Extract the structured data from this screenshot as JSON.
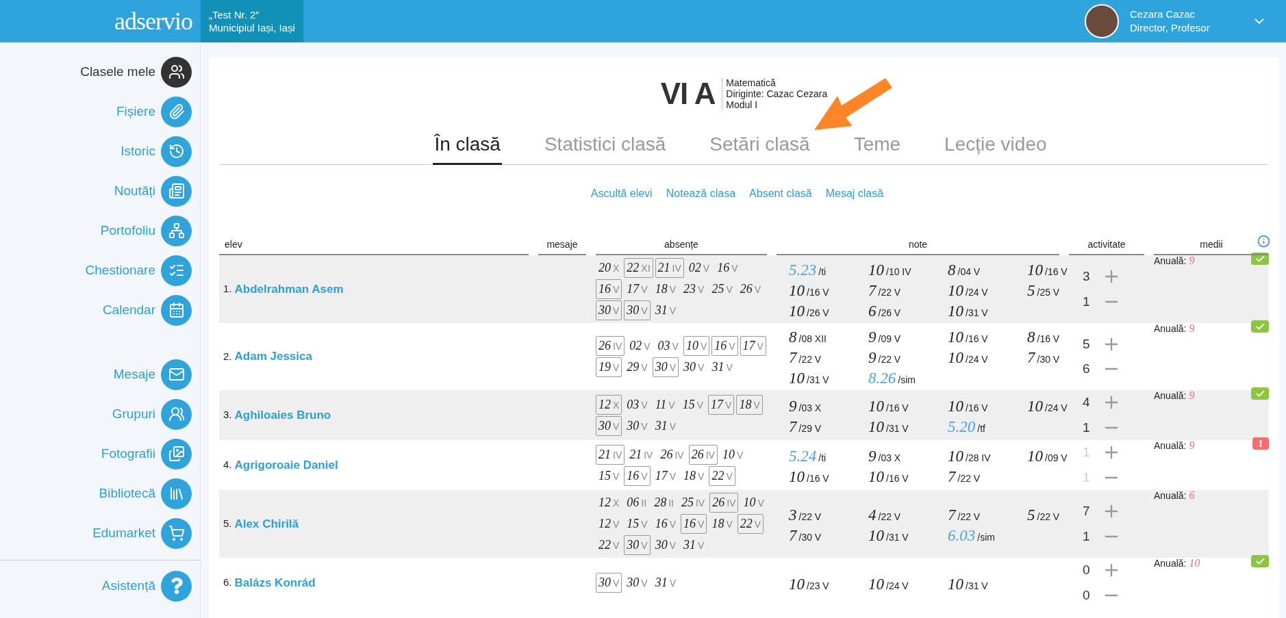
{
  "header": {
    "logo": "adservio",
    "school": {
      "name": "„Test Nr. 2”",
      "location": "Municipiul Iași, Iași"
    },
    "user": {
      "name": "Cezara Cazac",
      "role": "Director, Profesor"
    }
  },
  "sidebar": {
    "items": [
      {
        "label": "Clasele mele",
        "selected": true
      },
      {
        "label": "Fișiere",
        "selected": false
      },
      {
        "label": "Istoric",
        "selected": false
      },
      {
        "label": "Noutăți",
        "selected": false
      },
      {
        "label": "Portofoliu",
        "selected": false
      },
      {
        "label": "Chestionare",
        "selected": false
      },
      {
        "label": "Calendar",
        "selected": false
      }
    ],
    "items_2": [
      {
        "label": "Mesaje",
        "selected": false
      },
      {
        "label": "Grupuri",
        "selected": false
      },
      {
        "label": "Fotografii",
        "selected": false
      },
      {
        "label": "Bibliotecă",
        "selected": false
      },
      {
        "label": "Edumarket",
        "selected": false
      }
    ],
    "footer_item": {
      "label": "Asistență",
      "selected": false
    }
  },
  "class_info": {
    "name": "VI A",
    "subject": "Matematică",
    "head_teacher": "Diriginte: Cazac Cezara",
    "module": "Modul I"
  },
  "tabs": [
    {
      "label": "În clasă",
      "selected": true
    },
    {
      "label": "Statistici clasă",
      "selected": false
    },
    {
      "label": "Setări clasă",
      "selected": false
    },
    {
      "label": "Teme",
      "selected": false
    },
    {
      "label": "Lecție video",
      "selected": false
    }
  ],
  "actions": [
    "Ascultă elevi",
    "Notează clasa",
    "Absent clasă",
    "Mesaj clasă"
  ],
  "table": {
    "columns": [
      "elev",
      "mesaje",
      "absențe",
      "note",
      "activitate",
      "medii"
    ],
    "rows": [
      {
        "index": "1.",
        "name": "Abdelrahman Asem",
        "absences": [
          {
            "day": "20",
            "month": "X",
            "boxed": false
          },
          {
            "day": "22",
            "month": "XI",
            "boxed": true
          },
          {
            "day": "21",
            "month": "IV",
            "boxed": true
          },
          {
            "day": "02",
            "month": "V",
            "boxed": false
          },
          {
            "day": "16",
            "month": "V",
            "boxed": false
          },
          {
            "day": "16",
            "month": "V",
            "boxed": true
          },
          {
            "day": "17",
            "month": "V",
            "boxed": false
          },
          {
            "day": "18",
            "month": "V",
            "boxed": false
          },
          {
            "day": "23",
            "month": "V",
            "boxed": false
          },
          {
            "day": "25",
            "month": "V",
            "boxed": false
          },
          {
            "day": "26",
            "month": "V",
            "boxed": false
          },
          {
            "day": "30",
            "month": "V",
            "boxed": true
          },
          {
            "day": "30",
            "month": "V",
            "boxed": true
          },
          {
            "day": "31",
            "month": "V",
            "boxed": false
          }
        ],
        "grades": [
          {
            "value": "5.23",
            "date": "/ti",
            "kind": "average"
          },
          {
            "value": "10",
            "date": "/10 IV",
            "kind": "grade"
          },
          {
            "value": "8",
            "date": "/04 V",
            "kind": "grade"
          },
          {
            "value": "10",
            "date": "/16 V",
            "kind": "grade"
          },
          {
            "value": "10",
            "date": "/16 V",
            "kind": "grade"
          },
          {
            "value": "7",
            "date": "/22 V",
            "kind": "grade"
          },
          {
            "value": "10",
            "date": "/24 V",
            "kind": "grade"
          },
          {
            "value": "5",
            "date": "/25 V",
            "kind": "grade"
          },
          {
            "value": "10",
            "date": "/26 V",
            "kind": "grade"
          },
          {
            "value": "6",
            "date": "/26 V",
            "kind": "grade"
          },
          {
            "value": "10",
            "date": "/31 V",
            "kind": "grade"
          }
        ],
        "activity": {
          "plus": "3",
          "minus": "1",
          "dimmed": false
        },
        "average_label": "Anuală:",
        "average": "9",
        "badge": true,
        "warning": false
      },
      {
        "index": "2.",
        "name": "Adam Jessica",
        "absences": [
          {
            "day": "26",
            "month": "IV",
            "boxed": true
          },
          {
            "day": "02",
            "month": "V",
            "boxed": false
          },
          {
            "day": "03",
            "month": "V",
            "boxed": false
          },
          {
            "day": "10",
            "month": "V",
            "boxed": true
          },
          {
            "day": "16",
            "month": "V",
            "boxed": true
          },
          {
            "day": "17",
            "month": "V",
            "boxed": true
          },
          {
            "day": "19",
            "month": "V",
            "boxed": true
          },
          {
            "day": "29",
            "month": "V",
            "boxed": false
          },
          {
            "day": "30",
            "month": "V",
            "boxed": true
          },
          {
            "day": "30",
            "month": "V",
            "boxed": false
          },
          {
            "day": "31",
            "month": "V",
            "boxed": false
          }
        ],
        "grades": [
          {
            "value": "8",
            "date": "/08 XII",
            "kind": "grade"
          },
          {
            "value": "9",
            "date": "/09 V",
            "kind": "grade"
          },
          {
            "value": "10",
            "date": "/16 V",
            "kind": "grade"
          },
          {
            "value": "8",
            "date": "/16 V",
            "kind": "grade"
          },
          {
            "value": "7",
            "date": "/22 V",
            "kind": "grade"
          },
          {
            "value": "9",
            "date": "/22 V",
            "kind": "grade"
          },
          {
            "value": "10",
            "date": "/24 V",
            "kind": "grade"
          },
          {
            "value": "7",
            "date": "/30 V",
            "kind": "grade"
          },
          {
            "value": "10",
            "date": "/31 V",
            "kind": "grade"
          },
          {
            "value": "8.26",
            "date": "/sim",
            "kind": "average"
          }
        ],
        "activity": {
          "plus": "5",
          "minus": "6",
          "dimmed": false
        },
        "average_label": "Anuală:",
        "average": "9",
        "badge": true,
        "warning": false
      },
      {
        "index": "3.",
        "name": "Aghiloaies Bruno",
        "absences": [
          {
            "day": "12",
            "month": "X",
            "boxed": true
          },
          {
            "day": "03",
            "month": "V",
            "boxed": false
          },
          {
            "day": "11",
            "month": "V",
            "boxed": false
          },
          {
            "day": "15",
            "month": "V",
            "boxed": false
          },
          {
            "day": "17",
            "month": "V",
            "boxed": true
          },
          {
            "day": "18",
            "month": "V",
            "boxed": true
          },
          {
            "day": "30",
            "month": "V",
            "boxed": true
          },
          {
            "day": "30",
            "month": "V",
            "boxed": false
          },
          {
            "day": "31",
            "month": "V",
            "boxed": false
          }
        ],
        "grades": [
          {
            "value": "9",
            "date": "/03 X",
            "kind": "grade"
          },
          {
            "value": "10",
            "date": "/16 V",
            "kind": "grade"
          },
          {
            "value": "10",
            "date": "/16 V",
            "kind": "grade"
          },
          {
            "value": "10",
            "date": "/24 V",
            "kind": "grade"
          },
          {
            "value": "7",
            "date": "/29 V",
            "kind": "grade"
          },
          {
            "value": "10",
            "date": "/31 V",
            "kind": "grade"
          },
          {
            "value": "5.20",
            "date": "/tf",
            "kind": "average"
          }
        ],
        "activity": {
          "plus": "4",
          "minus": "1",
          "dimmed": false
        },
        "average_label": "Anuală:",
        "average": "9",
        "badge": true,
        "warning": false
      },
      {
        "index": "4.",
        "name": "Agrigoroaie Daniel",
        "absences": [
          {
            "day": "21",
            "month": "IV",
            "boxed": true
          },
          {
            "day": "21",
            "month": "IV",
            "boxed": false
          },
          {
            "day": "26",
            "month": "IV",
            "boxed": false
          },
          {
            "day": "26",
            "month": "IV",
            "boxed": true
          },
          {
            "day": "10",
            "month": "V",
            "boxed": false
          },
          {
            "day": "15",
            "month": "V",
            "boxed": false
          },
          {
            "day": "16",
            "month": "V",
            "boxed": true
          },
          {
            "day": "17",
            "month": "V",
            "boxed": false
          },
          {
            "day": "18",
            "month": "V",
            "boxed": false
          },
          {
            "day": "22",
            "month": "V",
            "boxed": true
          }
        ],
        "grades": [
          {
            "value": "5.24",
            "date": "/ti",
            "kind": "average"
          },
          {
            "value": "9",
            "date": "/03 X",
            "kind": "grade"
          },
          {
            "value": "10",
            "date": "/28 IV",
            "kind": "grade"
          },
          {
            "value": "10",
            "date": "/09 V",
            "kind": "grade"
          },
          {
            "value": "10",
            "date": "/16 V",
            "kind": "grade"
          },
          {
            "value": "10",
            "date": "/16 V",
            "kind": "grade"
          },
          {
            "value": "7",
            "date": "/22 V",
            "kind": "grade"
          }
        ],
        "activity": {
          "plus": "1",
          "minus": "1",
          "dimmed": true
        },
        "average_label": "Anuală:",
        "average": "9",
        "badge": true,
        "warning": true
      },
      {
        "index": "5.",
        "name": "Alex Chirilă",
        "absences": [
          {
            "day": "12",
            "month": "X",
            "boxed": false
          },
          {
            "day": "06",
            "month": "II",
            "boxed": false
          },
          {
            "day": "28",
            "month": "II",
            "boxed": false
          },
          {
            "day": "25",
            "month": "IV",
            "boxed": false
          },
          {
            "day": "26",
            "month": "IV",
            "boxed": true
          },
          {
            "day": "10",
            "month": "V",
            "boxed": false
          },
          {
            "day": "12",
            "month": "V",
            "boxed": false
          },
          {
            "day": "15",
            "month": "V",
            "boxed": false
          },
          {
            "day": "16",
            "month": "V",
            "boxed": false
          },
          {
            "day": "16",
            "month": "V",
            "boxed": true
          },
          {
            "day": "18",
            "month": "V",
            "boxed": false
          },
          {
            "day": "22",
            "month": "V",
            "boxed": true
          },
          {
            "day": "22",
            "month": "V",
            "boxed": false
          },
          {
            "day": "30",
            "month": "V",
            "boxed": true
          },
          {
            "day": "30",
            "month": "V",
            "boxed": false
          },
          {
            "day": "31",
            "month": "V",
            "boxed": false
          }
        ],
        "grades": [
          {
            "value": "3",
            "date": "/22 V",
            "kind": "grade"
          },
          {
            "value": "4",
            "date": "/22 V",
            "kind": "grade"
          },
          {
            "value": "7",
            "date": "/22 V",
            "kind": "grade"
          },
          {
            "value": "5",
            "date": "/22 V",
            "kind": "grade"
          },
          {
            "value": "7",
            "date": "/30 V",
            "kind": "grade"
          },
          {
            "value": "10",
            "date": "/31 V",
            "kind": "grade"
          },
          {
            "value": "6.03",
            "date": "/sim",
            "kind": "average"
          }
        ],
        "activity": {
          "plus": "7",
          "minus": "1",
          "dimmed": false
        },
        "average_label": "Anuală:",
        "average": "6",
        "badge": false
      },
      {
        "index": "6.",
        "name": "Balázs Konrád",
        "absences": [
          {
            "day": "30",
            "month": "V",
            "boxed": true
          },
          {
            "day": "30",
            "month": "V",
            "boxed": false
          },
          {
            "day": "31",
            "month": "V",
            "boxed": false
          }
        ],
        "grades": [
          {
            "value": "10",
            "date": "/23 V",
            "kind": "grade"
          },
          {
            "value": "10",
            "date": "/24 V",
            "kind": "grade"
          },
          {
            "value": "10",
            "date": "/31 V",
            "kind": "grade"
          }
        ],
        "activity": {
          "plus": "0",
          "minus": "0",
          "dimmed": false
        },
        "average_label": "Anuală:",
        "average": "10",
        "badge": true,
        "warning": false
      }
    ]
  }
}
